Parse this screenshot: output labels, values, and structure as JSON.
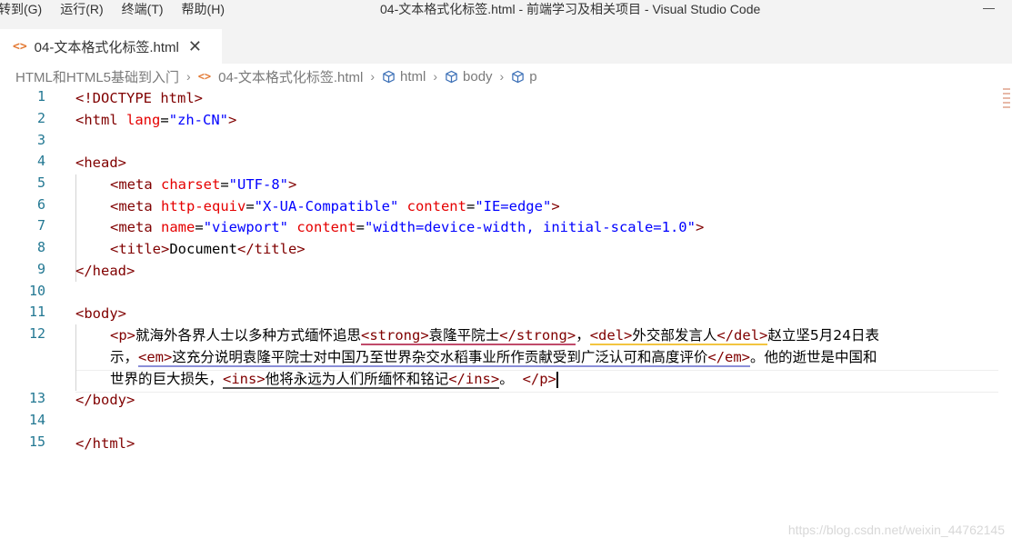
{
  "menubar": {
    "items": [
      "转到(G)",
      "运行(R)",
      "终端(T)",
      "帮助(H)"
    ]
  },
  "window": {
    "title": "04-文本格式化标签.html - 前端学习及相关项目 - Visual Studio Code"
  },
  "tab": {
    "label": "04-文本格式化标签.html",
    "close": "✕",
    "icon": "html-file-icon"
  },
  "breadcrumb": {
    "folder": "HTML和HTML5基础到入门",
    "file": "04-文本格式化标签.html",
    "html": "html",
    "body": "body",
    "p": "p"
  },
  "line_numbers": [
    "1",
    "2",
    "3",
    "4",
    "5",
    "6",
    "7",
    "8",
    "9",
    "10",
    "11",
    "12",
    "",
    "",
    "13",
    "14",
    "15"
  ],
  "code": {
    "l1_a": "<!DOCTYPE",
    "l1_b": " html",
    "l1_c": ">",
    "l2_a": "<html",
    "l2_b": " lang",
    "l2_c": "=",
    "l2_d": "\"zh-CN\"",
    "l2_e": ">",
    "l4_a": "<head>",
    "l5_a": "<meta",
    "l5_b": " charset",
    "l5_c": "=",
    "l5_d": "\"UTF-8\"",
    "l5_e": ">",
    "l6_a": "<meta",
    "l6_b": " http-equiv",
    "l6_c": "=",
    "l6_d": "\"X-UA-Compatible\"",
    "l6_e": " content",
    "l6_f": "=",
    "l6_g": "\"IE=edge\"",
    "l6_h": ">",
    "l7_a": "<meta",
    "l7_b": " name",
    "l7_c": "=",
    "l7_d": "\"viewport\"",
    "l7_e": " content",
    "l7_f": "=",
    "l7_g": "\"width=device-width, initial-scale=1.0\"",
    "l7_h": ">",
    "l8_a": "<title>",
    "l8_b": "Document",
    "l8_c": "</title>",
    "l9_a": "</head>",
    "l11_a": "<body>",
    "l12_p": "<p>",
    "l12_t1": "就海外各界人士以多种方式缅怀追思",
    "l12_s1": "<strong>",
    "l12_t2": "袁隆平院士",
    "l12_s2": "</strong>",
    "l12_t3": "，",
    "l12_d1": "<del>",
    "l12_t4": "外交部发言人",
    "l12_d2": "</del>",
    "l12_t5": "赵立坚5月24日表",
    "l12b_t1": "示，",
    "l12b_e1": "<em>",
    "l12b_t2": "这充分说明袁隆平院士对中国乃至世界杂交水稻事业所作贡献受到广泛认可和高度评价",
    "l12b_e2": "</em>",
    "l12b_t3": "。他的逝世是中国和",
    "l12c_t1": "世界的巨大损失，",
    "l12c_i1": "<ins>",
    "l12c_t2": "他将永远为人们所缅怀和铭记",
    "l12c_i2": "</ins>",
    "l12c_t3": "。  ",
    "l12c_p2": "</p>",
    "l13_a": "</body>",
    "l15_a": "</html>"
  },
  "watermark": "https://blog.csdn.net/weixin_44762145",
  "colors": {
    "tag": "#800000",
    "attribute": "#e50000",
    "value": "#0000ff",
    "line_number": "#237893"
  }
}
